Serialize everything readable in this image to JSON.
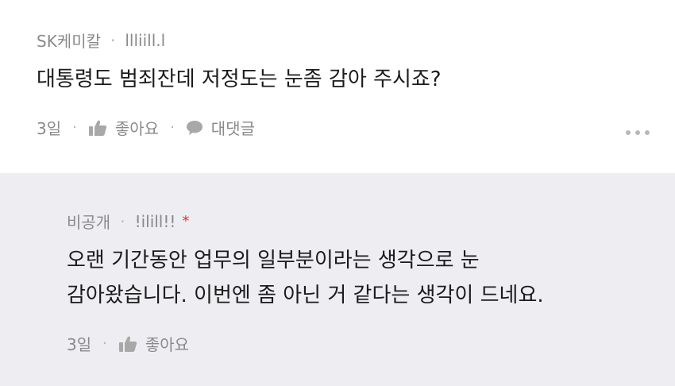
{
  "comment": {
    "company": "SK케미칼",
    "nickname": "llliill.l",
    "text": "대통령도 범죄잔데 저정도는 눈좀 감아 주시죠?",
    "time": "3일",
    "like_label": "좋아요",
    "reply_label": "대댓글",
    "icons": {
      "like": "thumbs-up-icon",
      "reply": "speech-bubble-icon",
      "more": "more-dots-icon"
    }
  },
  "reply": {
    "company": "비공개",
    "nickname": "!ilill!!",
    "author_mark": "*",
    "lines": [
      "오랜 기간동안 업무의 일부분이라는 생각으로 눈",
      "감아왔습니다. 이번엔 좀 아닌 거 같다는 생각이 드네요."
    ],
    "time": "3일",
    "like_label": "좋아요",
    "icons": {
      "like": "thumbs-up-icon"
    }
  },
  "colors": {
    "reply_background": "#eeeef2",
    "meta_text": "#8a8a8a",
    "body_text": "#1b1b1b",
    "author_mark": "#e03131"
  }
}
